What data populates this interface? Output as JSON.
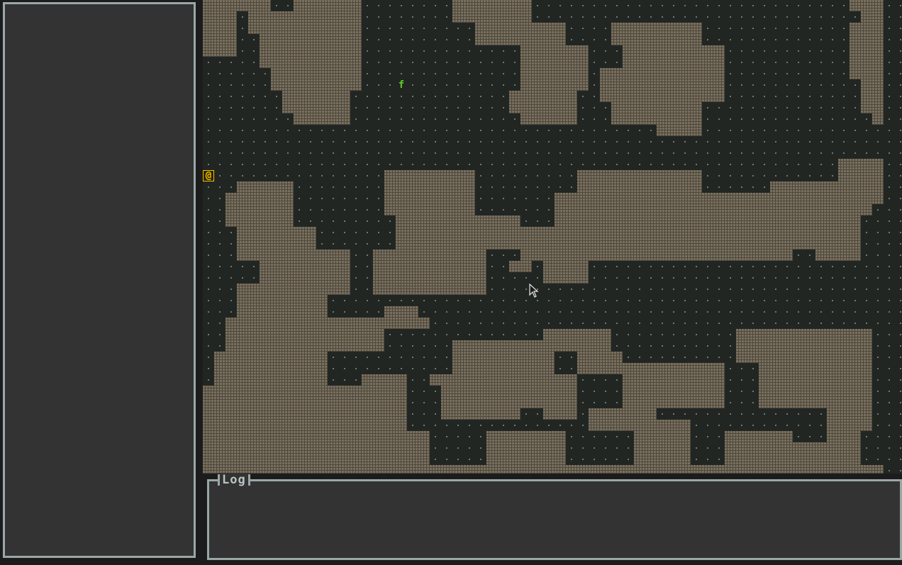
{
  "log": {
    "title": "Log",
    "lines": []
  },
  "sidebar": {
    "lines": []
  },
  "colors": {
    "floor": "#222623",
    "floor_dot": "#6f7a72",
    "wall": "#7a705e",
    "wall_line": "#4c473c",
    "panel_bg": "#333333",
    "panel_border": "#9aa7a7",
    "player": "#f2c200",
    "creature": "#5ecb1f"
  },
  "map": {
    "cell_size": 16,
    "legend": {
      "#": "wall",
      ".": "floor"
    },
    "rows": [
      "####...........#####......##########.....................#..",
      "####.........#######......##############............###.....",
      "###..........###########.........####....................###",
      "###...........##########..........####.................######",
      "##..............#########........#######...............######",
      "..................#######........#######...................##",
      ".....................####........########...................##",
      "......................#####.......#######.................###",
      "..........................##......#####........................",
      "....................................########....................",
      "......................................########....................",
      ".....................................................",
      "................................................................",
      "..................................................................",
      "...................................................................",
      "...........................##.......###..............................",
      "...................###.......##..........##...........##...........",
      "..................................#####........................",
      "....................................................................",
      "..........................................................",
      "...................................................................",
      ".....................................................",
      "....................................................",
      "...................................................",
      ".........................................................."
    ],
    "entities": [
      {
        "name": "player",
        "glyph": "@",
        "col": 0,
        "row": 15
      },
      {
        "name": "creature",
        "glyph": "f",
        "col": 17,
        "row": 7
      }
    ]
  }
}
